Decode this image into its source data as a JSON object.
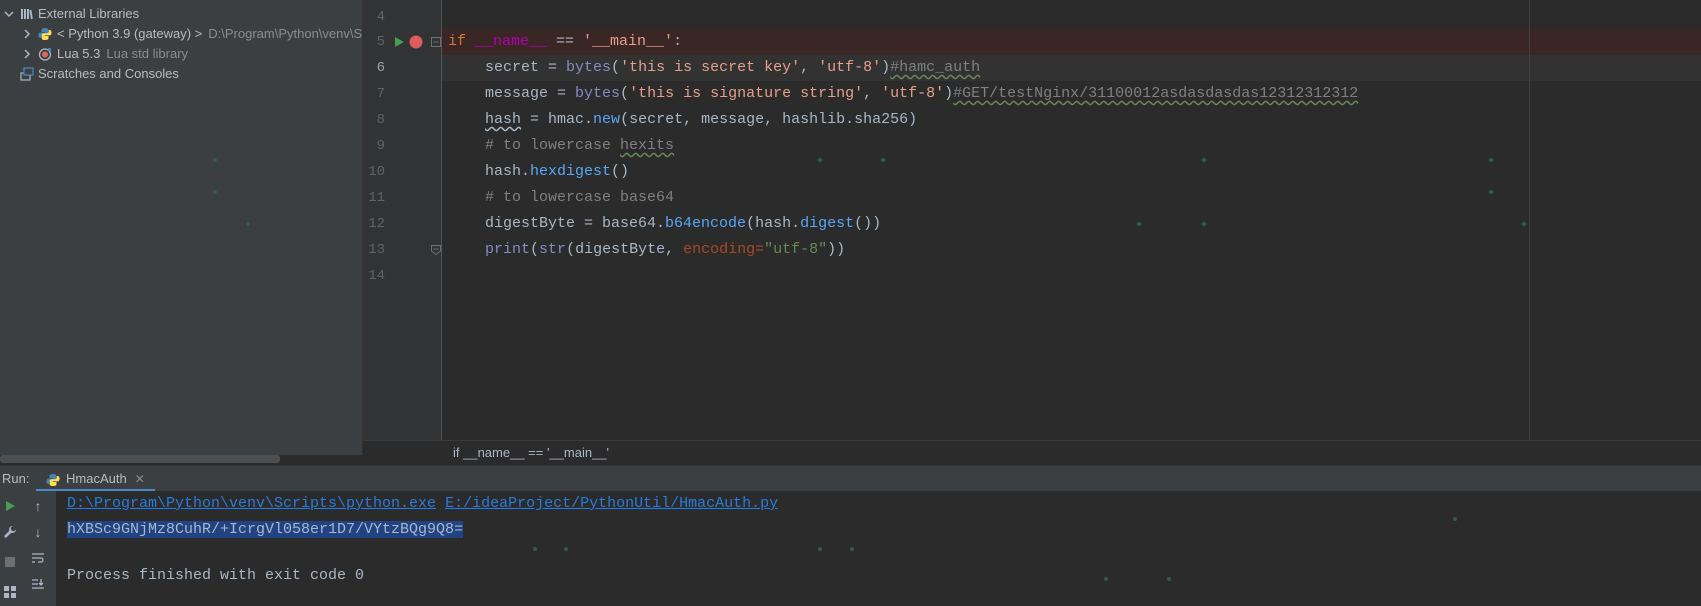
{
  "project_tree": {
    "items": [
      {
        "label": "External Libraries",
        "hint": "",
        "icon": "library-icon",
        "expanded": true
      },
      {
        "label": "< Python 3.9 (gateway) >",
        "hint": "D:\\Program\\Python\\venv\\S",
        "icon": "python-icon",
        "expanded": false
      },
      {
        "label": "Lua 5.3",
        "hint": "Lua std library",
        "icon": "lua-icon",
        "expanded": false
      },
      {
        "label": "Scratches and Consoles",
        "hint": "",
        "icon": "scratches-icon",
        "expanded": false
      }
    ]
  },
  "editor": {
    "line_numbers": [
      "4",
      "5",
      "6",
      "7",
      "8",
      "9",
      "10",
      "11",
      "12",
      "13",
      "14"
    ],
    "lines": {
      "l5": {
        "kw_if": "if ",
        "dunder_name": "__name__",
        "op": " == ",
        "str_main": "'__main__'",
        "colon": ":"
      },
      "l6": {
        "indent": "    ",
        "var": "secret = ",
        "fn": "bytes",
        "open": "(",
        "s1": "'this is secret key'",
        "comma": ", ",
        "s2": "'utf-8'",
        "close": ")",
        "comment": "#hamc_auth"
      },
      "l7": {
        "indent": "    ",
        "var": "message = ",
        "fn": "bytes",
        "open": "(",
        "s1": "'this is signature string'",
        "comma": ", ",
        "s2": "'utf-8'",
        "close": ")",
        "comment": "#GET/testNginx/31100012asdasdasdas12312312312"
      },
      "l8": {
        "indent": "    ",
        "var": "hash",
        "rest1": " = hmac.",
        "fn": "new",
        "rest2": "(secret, message, hashlib.sha256)"
      },
      "l9": {
        "indent": "    ",
        "comment1": "# to lowercase ",
        "comment2": "hexits"
      },
      "l10": {
        "indent": "    ",
        "obj": "hash.",
        "fn": "hexdigest",
        "rest": "()"
      },
      "l11": {
        "indent": "    ",
        "comment": "# to lowercase base64"
      },
      "l12": {
        "indent": "    ",
        "var": "digestByte = base64.",
        "fn": "b64encode",
        "rest1": "(hash.",
        "fn2": "digest",
        "rest2": "())"
      },
      "l13": {
        "indent": "    ",
        "fn": "print",
        "rest1": "(",
        "fn2": "str",
        "rest2": "(digestByte, ",
        "kwarg": "encoding=",
        "str": "\"utf-8\"",
        "rest3": "))"
      }
    },
    "breadcrumb": "if __name__ == '__main__'"
  },
  "run_panel": {
    "label": "Run:",
    "tab": "HmacAuth",
    "console": {
      "python_path": "D:\\Program\\Python\\venv\\Scripts\\python.exe",
      "script_path": "E:/ideaProject/PythonUtil/HmacAuth.py",
      "output": "hXBSc9GNjMz8CuhR/+IcrgVl058er1D7/VYtzBQg9Q8=",
      "exit": "Process finished with exit code 0"
    }
  },
  "colors": {
    "keyword": "#cc7832",
    "string": "#6a8759",
    "link": "#287bde",
    "selection": "#214283",
    "run_green": "#499c54",
    "breakpoint_red": "#db5c5c"
  }
}
